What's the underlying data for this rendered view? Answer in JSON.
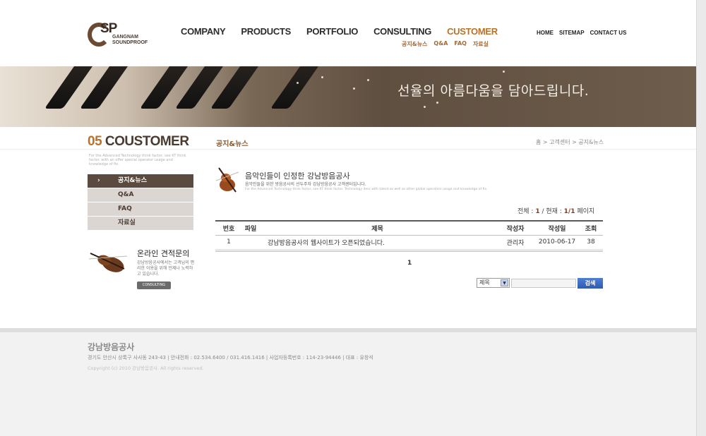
{
  "logo": {
    "mark": "SP",
    "line1": "GANGNAM",
    "line2": "SOUNDPROOF"
  },
  "gnb": [
    "COMPANY",
    "PRODUCTS",
    "PORTFOLIO",
    "CONSULTING",
    "CUSTOMER"
  ],
  "subnav": [
    "공지&뉴스",
    "Q&A",
    "FAQ",
    "자료실"
  ],
  "util": [
    "HOME",
    "SITEMAP",
    "CONTACT US"
  ],
  "banner": {
    "text": "선율의 아름다움을 담아드립니다."
  },
  "section": {
    "num": "05",
    "title": "COUSTOMER",
    "desc": "For the Advanced Technology think factor, see KT think factor. with an offer special operator usage and knowledge of fix.",
    "page_title": "공지&뉴스",
    "breadcrumb": "홈 > 고객센터 > 공지&뉴스"
  },
  "lnb": [
    "공지&뉴스",
    "Q&A",
    "FAQ",
    "자료실"
  ],
  "inquiry": {
    "title": "온라인 견적문의",
    "desc": "강남방음공사에서는 고객님의 편리한 이용을 위해 언제나 노력하고 있습니다.",
    "button": "CONSULTING"
  },
  "intro": {
    "title": "음악인들이 인정한 강남방음공사",
    "sub": "음악인들을 위한 방음공사의 선두주자 강남방음공사 고객센터입니다.",
    "eng": "For the Advanced Technology think factor, see KT think factor. Technology desc with talent as well as other global operation usage and knowledge of fix."
  },
  "count": {
    "total_label": "전체 : ",
    "total": "1",
    "sep": " / 현재 : ",
    "current": "1/1",
    "suffix": " 페이지"
  },
  "board": {
    "headers": [
      "번호",
      "파일",
      "제목",
      "작성자",
      "작성일",
      "조회"
    ],
    "rows": [
      {
        "no": "1",
        "file": "",
        "title": "강남방음공사의 웹사이트가 오픈되었습니다.",
        "author": "관리자",
        "date": "2010-06-17",
        "views": "38"
      }
    ]
  },
  "pager": "1",
  "search": {
    "option": "제목",
    "button": "검색"
  },
  "footer": {
    "name": "강남방음공사",
    "address": "경기도 안산시 상록구 사사동 243-43  |  안내전화 : 02.534.6400 / 031.416.1416  |  사업자등록번호 : 114-23-94446  |  대표 : 유창석",
    "copyright": "Copyright (c) 2010 강남방음공사. All rights reserved."
  },
  "colors": {
    "accent": "#b9722a",
    "brown": "#5b4a40",
    "search_button": "#2e5ab3"
  }
}
